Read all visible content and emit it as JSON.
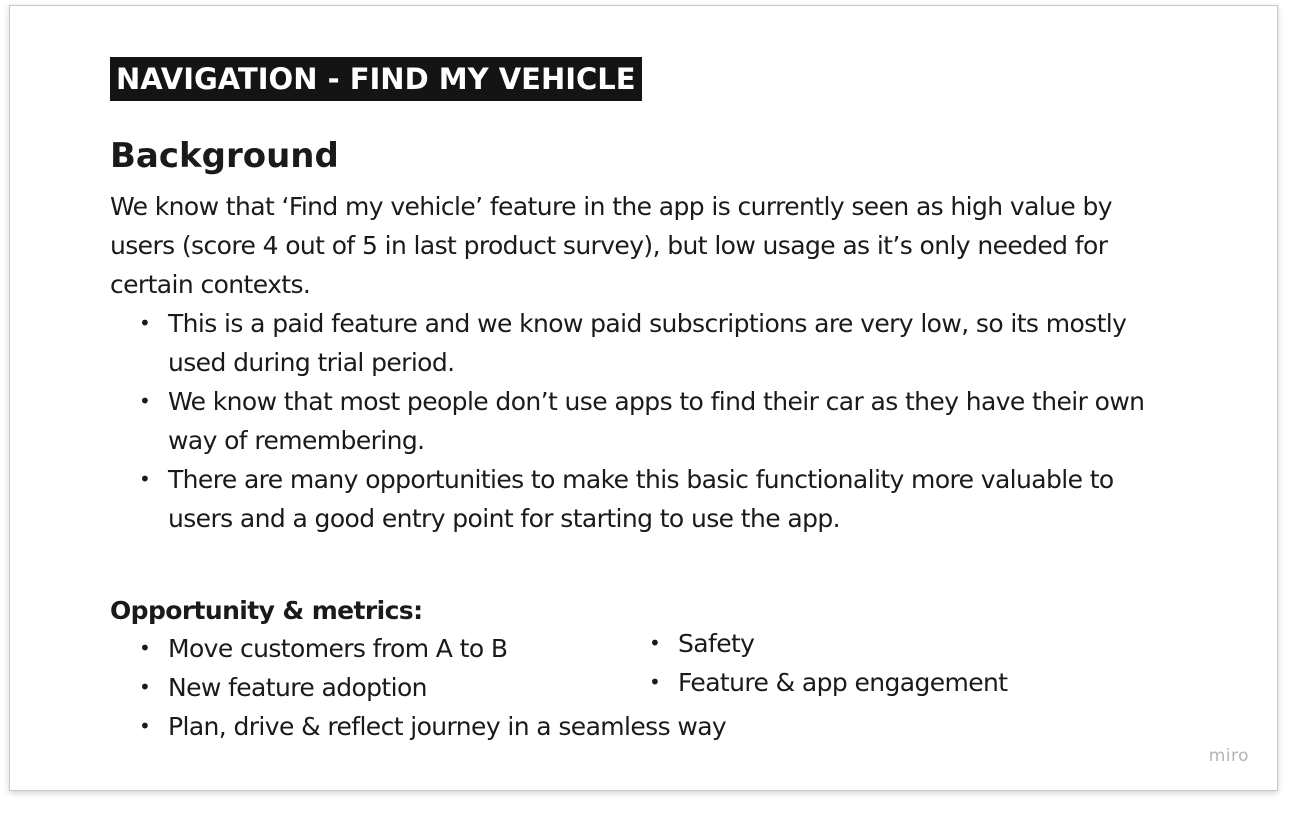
{
  "title_badge": "NAVIGATION - FIND MY VEHICLE",
  "heading": "Background",
  "intro": "We know that ‘Find my vehicle’ feature in the app is currently seen as high value by users (score 4 out of 5 in last product survey), but low usage as it’s only needed for certain contexts.",
  "bullet_glyph": "•",
  "background_bullets": [
    "This is a paid feature and we know paid subscriptions are very low, so its mostly used during trial period.",
    "We know that most people don’t use apps to find their car as they have their own way of remembering.",
    "There are many opportunities to make this basic functionality more valuable to users and a good entry point for starting to use the app."
  ],
  "metrics_heading": "Opportunity & metrics:",
  "metrics_left": [
    "Move customers from A to B",
    "New feature adoption",
    "Plan, drive & reflect journey in a seamless way"
  ],
  "metrics_right": [
    "Safety",
    "Feature & app engagement"
  ],
  "watermark": "miro"
}
